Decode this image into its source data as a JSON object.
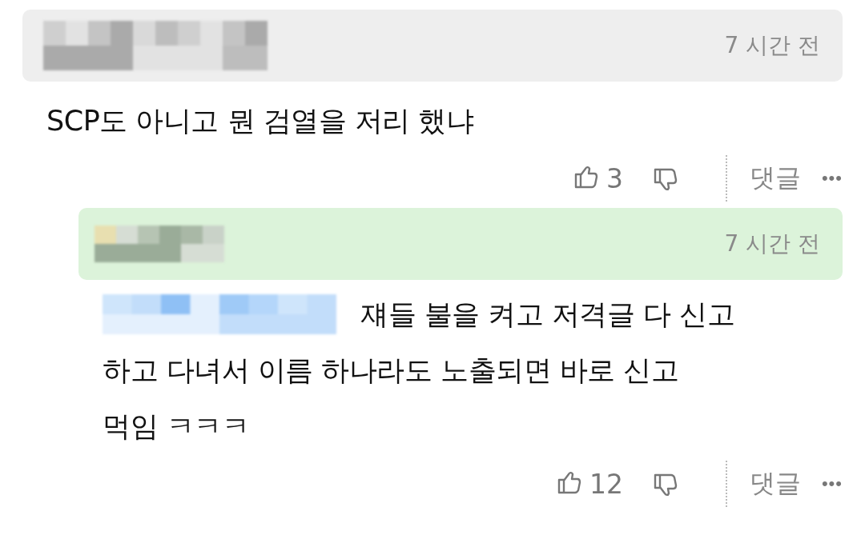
{
  "comments": [
    {
      "kind": "comment",
      "highlighted": false,
      "time": "7 시간 전",
      "lines": [
        "SCP도 아니고 뭔 검열을 저리 했냐"
      ],
      "likes": "3",
      "reply_label": "댓글",
      "more": "•••"
    },
    {
      "kind": "reply",
      "highlighted": true,
      "time": "7 시간 전",
      "has_mention": true,
      "lines": [
        "쟤들 불을 켜고 저격글 다 신고",
        "하고 다녀서 이름 하나라도 노출되면 바로 신고",
        "먹임 ㅋㅋㅋ"
      ],
      "likes": "12",
      "reply_label": "댓글",
      "more": "•••"
    }
  ]
}
